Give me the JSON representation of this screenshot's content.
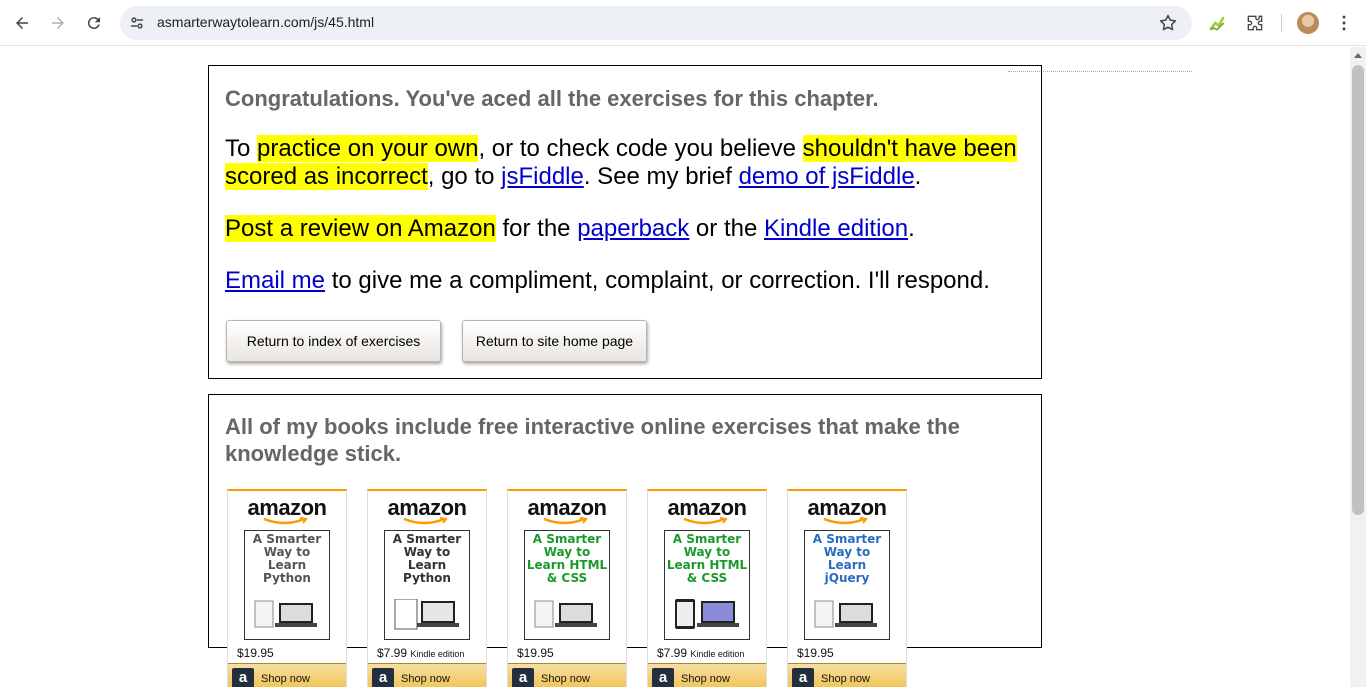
{
  "browser": {
    "url": "asmarterwaytolearn.com/js/45.html"
  },
  "page": {
    "congrats_heading": "Congratulations. You've aced all the exercises for this chapter.",
    "para1": {
      "t1": "To ",
      "hl1": "practice on your own",
      "t2": ", or to check code you believe ",
      "hl2": "shouldn't have been scored as incorrect",
      "t3": ", go to ",
      "link_jsfiddle": "jsFiddle",
      "t4": ". See my brief ",
      "link_demo": "demo of jsFiddle",
      "t5": "."
    },
    "para2": {
      "hl": "Post a review on Amazon",
      "t1": " for the ",
      "link_paperback": "paperback",
      "t2": " or the ",
      "link_kindle": "Kindle edition",
      "t3": "."
    },
    "para3": {
      "link_email": "Email me",
      "t1": " to give me a compliment, complaint, or correction. I'll respond."
    },
    "buttons": {
      "index": "Return to index of exercises",
      "home": "Return to site home page"
    },
    "books_heading": "All of my books include free interactive online exercises that make the knowledge stick."
  },
  "books": [
    {
      "logo": "amazon",
      "title": "A Smarter Way to Learn Python",
      "title_color": "#555555",
      "price": "$19.95",
      "edition": "",
      "shop": "Shop now"
    },
    {
      "logo": "amazon",
      "title": "A Smarter Way to Learn Python",
      "title_color": "#333333",
      "price": "$7.99",
      "edition": "Kindle edition",
      "shop": "Shop now"
    },
    {
      "logo": "amazon",
      "title": "A Smarter Way to Learn HTML & CSS",
      "title_color": "#1a9a2a",
      "price": "$19.95",
      "edition": "",
      "shop": "Shop now"
    },
    {
      "logo": "amazon",
      "title": "A Smarter Way to Learn HTML & CSS",
      "title_color": "#1a9a2a",
      "price": "$7.99",
      "edition": "Kindle edition",
      "shop": "Shop now"
    },
    {
      "logo": "amazon",
      "title": "A Smarter Way to Learn jQuery",
      "title_color": "#2a6bc2",
      "price": "$19.95",
      "edition": "",
      "shop": "Shop now"
    }
  ]
}
